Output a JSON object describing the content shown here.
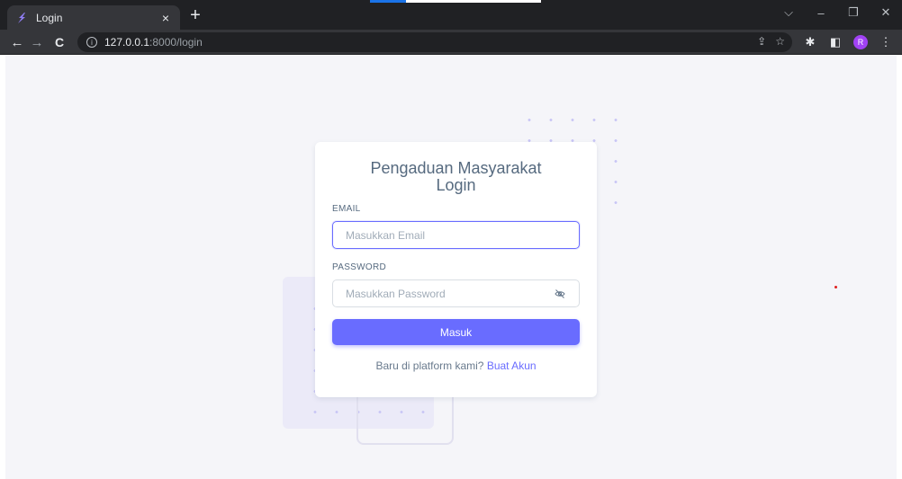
{
  "browser": {
    "tab": {
      "title": "Login",
      "close_glyph": "×"
    },
    "new_tab_glyph": "+",
    "window_controls": {
      "collapse": "⌵",
      "minimize": "–",
      "restore": "❐",
      "close": "✕"
    },
    "nav": {
      "back": "←",
      "forward": "→",
      "reload": "C"
    },
    "address": {
      "info_glyph": "i",
      "host": "127.0.0.1",
      "path": ":8000/login"
    },
    "omnibox_actions": {
      "share": "⇪",
      "bookmark": "☆"
    },
    "toolbar": {
      "extensions": "✱",
      "side_panel": "◧",
      "profile_initial": "R",
      "menu": "⋮"
    },
    "colors": {
      "frame": "#202124",
      "toolbar": "#35363a",
      "avatar": "#a142f4"
    }
  },
  "login": {
    "title_line1": "Pengaduan Masyarakat",
    "title_line2": "Login",
    "email_label": "EMAIL",
    "email_placeholder": "Masukkan Email",
    "password_label": "PASSWORD",
    "password_placeholder": "Masukkan Password",
    "submit_label": "Masuk",
    "footer_text": "Baru di platform kami? ",
    "footer_link": "Buat Akun",
    "colors": {
      "primary": "#696cff",
      "text": "#566a7f",
      "background": "#f5f5f9"
    }
  }
}
